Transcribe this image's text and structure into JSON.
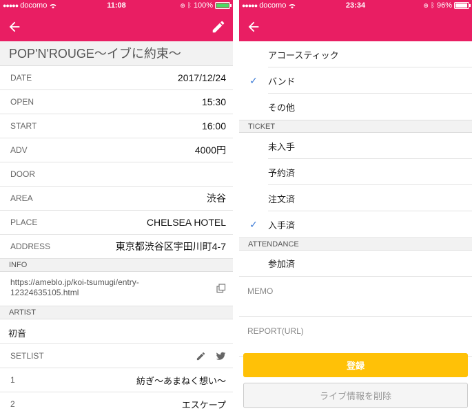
{
  "left": {
    "status": {
      "carrier": "docomo",
      "time": "11:08",
      "battery": "100%"
    },
    "title": "POP'N'ROUGE〜イブに約束〜",
    "fields": [
      {
        "key": "DATE",
        "value": "2017/12/24"
      },
      {
        "key": "OPEN",
        "value": "15:30"
      },
      {
        "key": "START",
        "value": "16:00"
      },
      {
        "key": "ADV",
        "value": "4000円"
      },
      {
        "key": "DOOR",
        "value": ""
      },
      {
        "key": "AREA",
        "value": "渋谷"
      },
      {
        "key": "PLACE",
        "value": "CHELSEA HOTEL"
      },
      {
        "key": "ADDRESS",
        "value": "東京都渋谷区宇田川町4-7"
      }
    ],
    "info_section": "INFO",
    "info_url": "https://ameblo.jp/koi-tsumugi/entry-12324635105.html",
    "artist_section": "ARTIST",
    "artist": "初音",
    "setlist_label": "SETLIST",
    "setlist": [
      {
        "num": "1",
        "title": "紡ぎ〜あまねく想い〜"
      },
      {
        "num": "2",
        "title": "エスケープ"
      }
    ]
  },
  "right": {
    "status": {
      "carrier": "docomo",
      "time": "23:34",
      "battery": "96%"
    },
    "genres": [
      {
        "label": "アコースティック",
        "checked": false
      },
      {
        "label": "バンド",
        "checked": true
      },
      {
        "label": "その他",
        "checked": false
      }
    ],
    "ticket_section": "TICKET",
    "tickets": [
      {
        "label": "未入手",
        "checked": false
      },
      {
        "label": "予約済",
        "checked": false
      },
      {
        "label": "注文済",
        "checked": false
      },
      {
        "label": "入手済",
        "checked": true
      }
    ],
    "attendance_section": "ATTENDANCE",
    "attendance": [
      {
        "label": "参加済",
        "checked": false
      }
    ],
    "memo_placeholder": "MEMO",
    "report_placeholder": "REPORT(URL)",
    "register_label": "登録",
    "delete_label": "ライブ情報を削除"
  },
  "colors": {
    "accent": "#e91e63",
    "check": "#3b7ad6",
    "primary_button": "#ffc107"
  }
}
